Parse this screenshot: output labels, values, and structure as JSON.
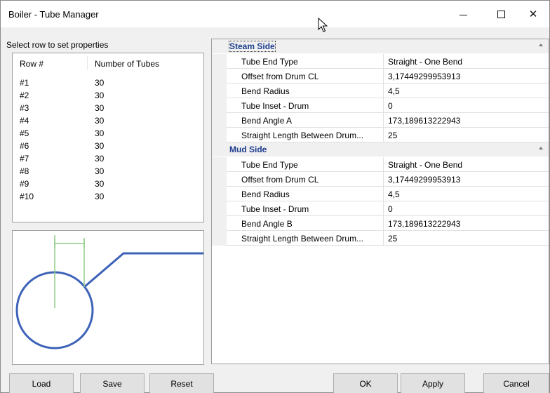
{
  "window": {
    "title": "Boiler - Tube Manager",
    "minimize_icon": "minimize-icon",
    "maximize_icon": "maximize-icon",
    "close_glyph": "✕"
  },
  "left": {
    "instruction": "Select row to set properties",
    "columns": [
      "Row #",
      "Number of Tubes"
    ],
    "rows": [
      {
        "row": "#1",
        "tubes": "30"
      },
      {
        "row": "#2",
        "tubes": "30"
      },
      {
        "row": "#3",
        "tubes": "30"
      },
      {
        "row": "#4",
        "tubes": "30"
      },
      {
        "row": "#5",
        "tubes": "30"
      },
      {
        "row": "#6",
        "tubes": "30"
      },
      {
        "row": "#7",
        "tubes": "30"
      },
      {
        "row": "#8",
        "tubes": "30"
      },
      {
        "row": "#9",
        "tubes": "30"
      },
      {
        "row": "#10",
        "tubes": "30"
      }
    ]
  },
  "properties": {
    "steam": {
      "label": "Steam Side",
      "items": [
        {
          "name": "Tube End Type",
          "value": "Straight - One Bend"
        },
        {
          "name": "Offset from Drum CL",
          "value": "3,17449299953913"
        },
        {
          "name": "Bend Radius",
          "value": "4,5"
        },
        {
          "name": "Tube Inset - Drum",
          "value": "0"
        },
        {
          "name": "Bend Angle A",
          "value": "173,189613222943"
        },
        {
          "name": "Straight Length Between Drum...",
          "value": "25"
        }
      ]
    },
    "mud": {
      "label": "Mud Side",
      "items": [
        {
          "name": "Tube End Type",
          "value": "Straight - One Bend"
        },
        {
          "name": "Offset from Drum CL",
          "value": "3,17449299953913"
        },
        {
          "name": "Bend Radius",
          "value": "4,5"
        },
        {
          "name": "Tube Inset - Drum",
          "value": "0"
        },
        {
          "name": "Bend Angle B",
          "value": "173,189613222943"
        },
        {
          "name": "Straight Length Between Drum...",
          "value": "25"
        }
      ]
    }
  },
  "buttons": {
    "load": "Load",
    "save": "Save",
    "reset": "Reset",
    "ok": "OK",
    "apply": "Apply",
    "cancel": "Cancel"
  },
  "colors": {
    "category_text": "#1c3d8f",
    "drum_stroke": "#3d62b8",
    "dimension_lines": "#8fcc86"
  }
}
